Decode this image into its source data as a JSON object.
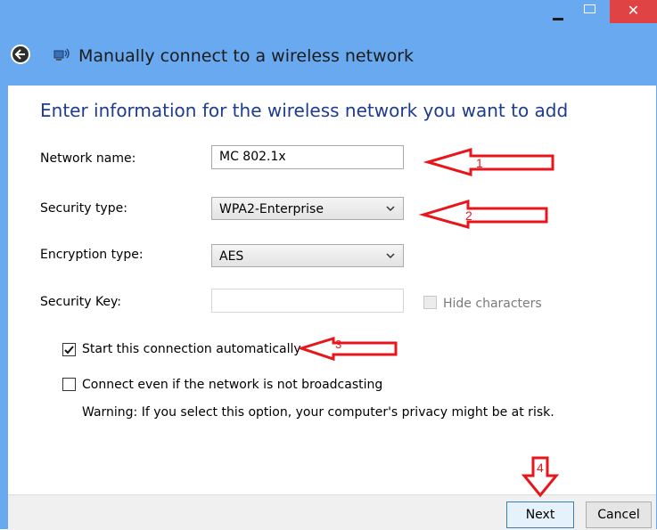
{
  "window": {
    "title": "Manually connect to a wireless network",
    "controls": {
      "close": "✕"
    }
  },
  "heading": "Enter information for the wireless network you want to add",
  "form": {
    "network_name": {
      "label": "Network name:",
      "value": "MC 802.1x"
    },
    "security_type": {
      "label": "Security type:",
      "value": "WPA2-Enterprise"
    },
    "encryption_type": {
      "label": "Encryption type:",
      "value": "AES"
    },
    "security_key": {
      "label": "Security Key:",
      "value": "",
      "hide_label": "Hide characters",
      "hide_checked": false
    },
    "start_auto": {
      "label": "Start this connection automatically",
      "checked": true
    },
    "connect_even": {
      "label": "Connect even if the network is not broadcasting",
      "checked": false
    },
    "warning": "Warning: If you select this option, your computer's privacy might be at risk."
  },
  "buttons": {
    "next": "Next",
    "cancel": "Cancel"
  },
  "annotations": {
    "color": "#e8161b",
    "numbers": [
      "1",
      "2",
      "3",
      "4"
    ]
  },
  "colors": {
    "titlebar": "#69a9ef",
    "heading": "#1e3c8f",
    "close": "#e04343"
  }
}
